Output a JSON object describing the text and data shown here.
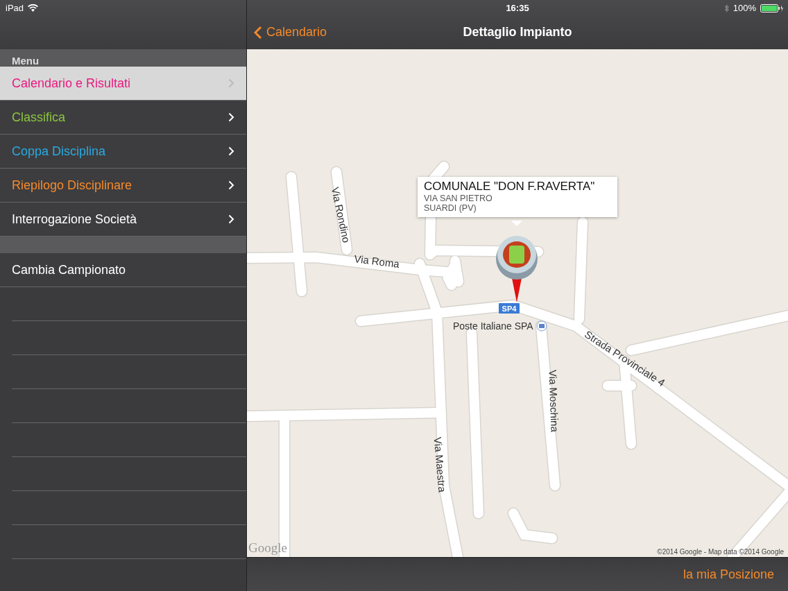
{
  "status_bar": {
    "device": "iPad",
    "time": "16:35",
    "battery": "100%"
  },
  "nav": {
    "back": "Calendario",
    "title": "Dettaglio Impianto"
  },
  "sidebar": {
    "header": "Menu",
    "items": [
      {
        "label": "Calendario e Risultati",
        "color": "#e8197f",
        "selected": true
      },
      {
        "label": "Classifica",
        "color": "#8dc63f",
        "selected": false
      },
      {
        "label": "Coppa Disciplina",
        "color": "#29abe2",
        "selected": false
      },
      {
        "label": "Riepilogo Disciplinare",
        "color": "#f58a2a",
        "selected": false
      },
      {
        "label": "Interrogazione Società",
        "color": "#ffffff",
        "selected": false
      }
    ],
    "extra_items": [
      {
        "label": "Cambia Campionato"
      }
    ]
  },
  "map": {
    "callout": {
      "title": "COMUNALE \"DON F.RAVERTA\"",
      "lines": [
        "VIA SAN PIETRO",
        "SUARDI (PV)"
      ]
    },
    "road_labels": [
      "Via Rondino",
      "Via Roma",
      "Via Maestra",
      "Via Moschina",
      "Strada Provinciale 4"
    ],
    "poi": "Poste Italiane SPA",
    "shield": "SP4",
    "logo": "Google",
    "attribution": "©2014 Google - Map data ©2014 Google"
  },
  "toolbar": {
    "button": "la mia Posizione"
  }
}
